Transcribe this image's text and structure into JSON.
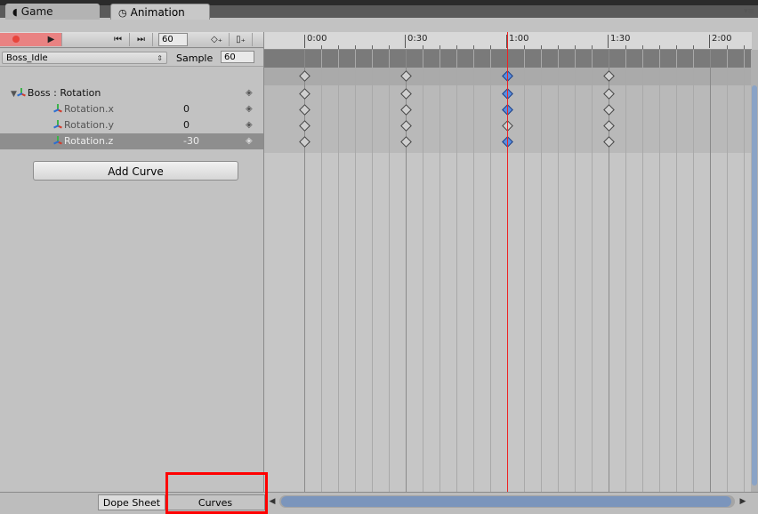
{
  "tabs": [
    {
      "label": "Game",
      "icon": "pacman-icon"
    },
    {
      "label": "Animation",
      "icon": "clock-icon"
    }
  ],
  "toolbar": {
    "frame": "60",
    "record_icon": "record-dot-icon",
    "play_icon": "play-icon"
  },
  "clip": {
    "name": "Boss_Idle",
    "sample_label": "Sample",
    "sample_value": "60"
  },
  "properties": [
    {
      "label": "Boss : Rotation",
      "value": ""
    },
    {
      "label": "Rotation.x",
      "value": "0"
    },
    {
      "label": "Rotation.y",
      "value": "0"
    },
    {
      "label": "Rotation.z",
      "value": "-30"
    }
  ],
  "add_curve_label": "Add Curve",
  "ruler": {
    "labels": [
      "0:00",
      "0:30",
      "1:00",
      "1:30",
      "2:00"
    ]
  },
  "keyframes_at": [
    "0:00",
    "0:30",
    "1:00",
    "1:30"
  ],
  "current_time": "1:00",
  "bottom": {
    "dopesheet_label": "Dope Sheet",
    "curves_label": "Curves"
  },
  "colors": {
    "record_active": "#e98282",
    "playhead": "#ee2222",
    "selected_key": "#5a8de0",
    "highlight": "#ff0000"
  }
}
